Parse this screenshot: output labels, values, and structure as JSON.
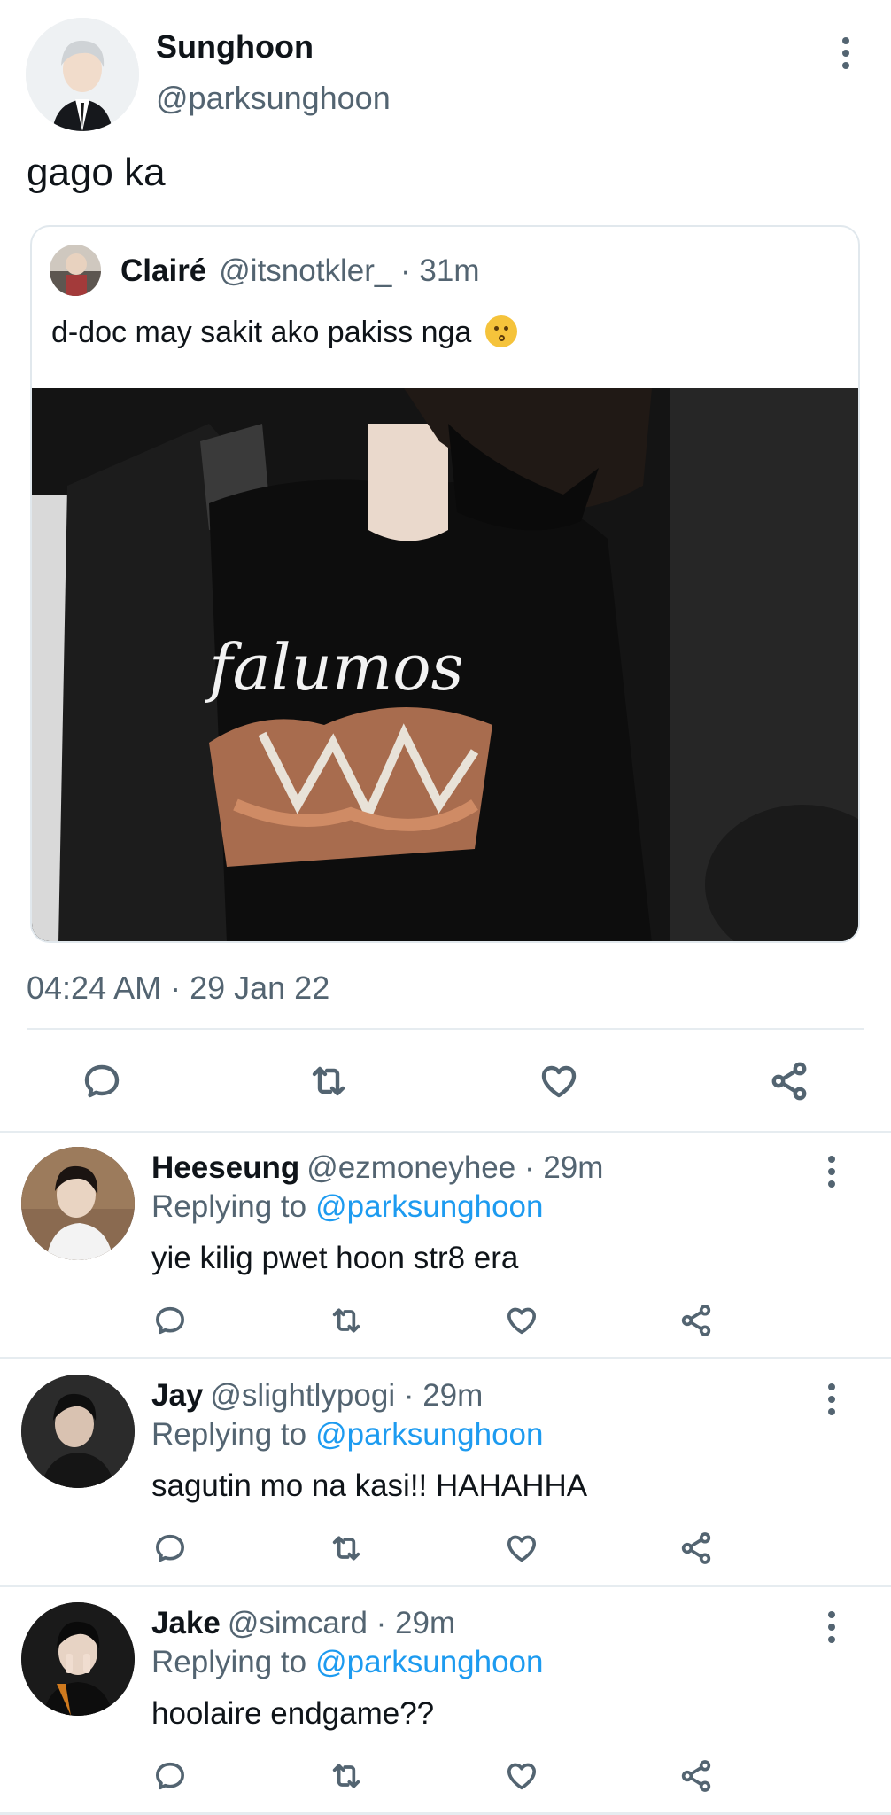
{
  "main_tweet": {
    "author_name": "Sunghoon",
    "author_handle": "@parksunghoon",
    "text": "gago ka",
    "timestamp": "04:24 AM · 29 Jan 22",
    "more_icon": "more-vertical-icon",
    "quoted": {
      "author_name": "Clairé",
      "meta": "@itsnotkler_ · 31m",
      "text": "d-doc may sakit ako pakiss nga",
      "emoji": "kissing-face-emoji"
    }
  },
  "actions": {
    "reply_icon": "reply-icon",
    "retweet_icon": "retweet-icon",
    "like_icon": "like-icon",
    "share_icon": "share-icon"
  },
  "replies": [
    {
      "author_name": "Heeseung",
      "meta": "@ezmoneyhee · 29m",
      "replying_prefix": "Replying to",
      "replying_handle": "@parksunghoon",
      "text": "yie kilig pwet hoon str8 era"
    },
    {
      "author_name": "Jay",
      "meta": "@slightlypogi · 29m",
      "replying_prefix": "Replying to",
      "replying_handle": "@parksunghoon",
      "text": "sagutin mo na kasi!! HAHAHHA"
    },
    {
      "author_name": "Jake",
      "meta": "@simcard · 29m",
      "replying_prefix": "Replying to",
      "replying_handle": "@parksunghoon",
      "text": "hoolaire endgame??"
    }
  ],
  "colors": {
    "text_primary": "#0f1419",
    "text_secondary": "#536471",
    "link": "#1d9bf0",
    "divider": "#e6ecf0"
  }
}
